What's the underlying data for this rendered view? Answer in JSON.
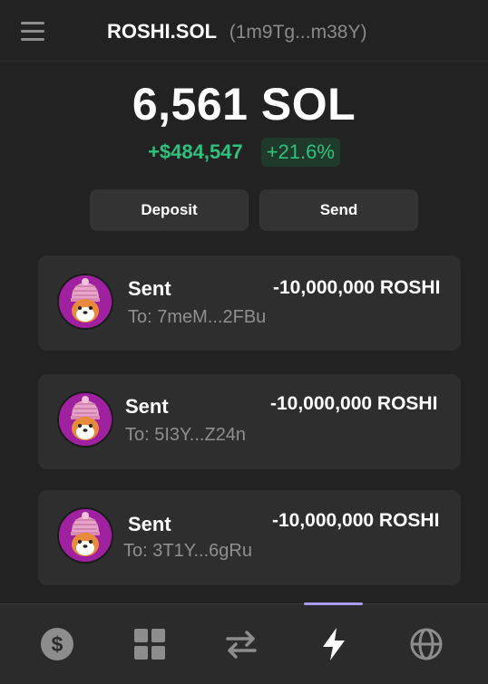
{
  "header": {
    "wallet_name": "ROSHI.SOL",
    "wallet_address": "(1m9Tg...m38Y)",
    "menu_icon": "hamburger-menu-icon"
  },
  "balance": {
    "amount": "6,561 SOL",
    "change_usd": "+$484,547",
    "change_percent": "+21.6%"
  },
  "actions": {
    "deposit_label": "Deposit",
    "send_label": "Send"
  },
  "transactions": [
    {
      "type": "Sent",
      "to": "To: 7meM...2FBu",
      "amount": "-10,000,000 ROSHI"
    },
    {
      "type": "Sent",
      "to": "To: 5I3Y...Z24n",
      "amount": "-10,000,000 ROSHI"
    },
    {
      "type": "Sent",
      "to": "To: 3T1Y...6gRu",
      "amount": "-10,000,000 ROSHI"
    }
  ],
  "nav": {
    "items": [
      {
        "icon": "dollar-coin-icon"
      },
      {
        "icon": "grid-icon"
      },
      {
        "icon": "swap-arrows-icon"
      },
      {
        "icon": "lightning-icon",
        "active": true
      },
      {
        "icon": "globe-icon"
      }
    ]
  },
  "colors": {
    "background": "#222222",
    "positive": "#2ec27e",
    "accent": "#a99bf0",
    "avatar": "#a0219f"
  }
}
